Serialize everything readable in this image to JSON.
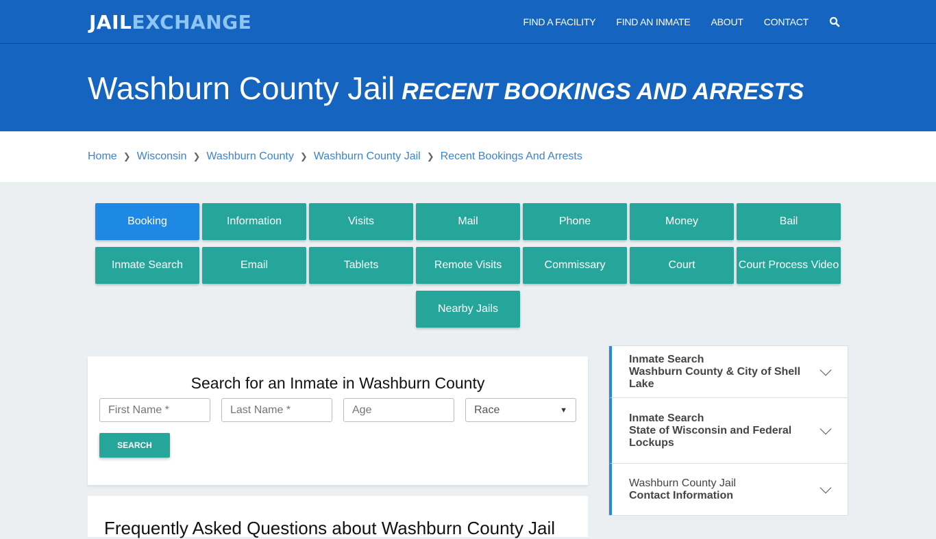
{
  "header": {
    "logo_part1": "JAIL",
    "logo_part2": "EXCHANGE",
    "nav": [
      "FIND A FACILITY",
      "FIND AN INMATE",
      "ABOUT",
      "CONTACT"
    ],
    "search_icon": "search-icon"
  },
  "hero": {
    "title": "Washburn County Jail",
    "subtitle": "RECENT BOOKINGS AND ARRESTS"
  },
  "breadcrumb": [
    "Home",
    "Wisconsin",
    "Washburn County",
    "Washburn County Jail",
    "Recent Bookings And Arrests"
  ],
  "tiles": [
    {
      "label": "Booking",
      "active": true
    },
    {
      "label": "Information"
    },
    {
      "label": "Visits"
    },
    {
      "label": "Mail"
    },
    {
      "label": "Phone"
    },
    {
      "label": "Money"
    },
    {
      "label": "Bail"
    },
    {
      "label": "Inmate Search"
    },
    {
      "label": "Email"
    },
    {
      "label": "Tablets"
    },
    {
      "label": "Remote Visits"
    },
    {
      "label": "Commissary"
    },
    {
      "label": "Court"
    },
    {
      "label": "Court Process Video"
    },
    {
      "label": "Nearby Jails"
    }
  ],
  "search": {
    "title": "Search for an Inmate in Washburn County",
    "first_name_placeholder": "First Name *",
    "last_name_placeholder": "Last Name *",
    "age_placeholder": "Age",
    "race_selected": "Race",
    "button": "SEARCH"
  },
  "faq": {
    "title": "Frequently Asked Questions about Washburn County Jail"
  },
  "sidebar": [
    {
      "line1": "Inmate Search",
      "line2": "Washburn County & City of Shell Lake"
    },
    {
      "line1": "Inmate Search",
      "line2": "State of Wisconsin and Federal Lockups"
    },
    {
      "line1": "Washburn County Jail",
      "line2": "Contact Information"
    }
  ],
  "colors": {
    "primary": "#1565c0",
    "teal": "#26a69a",
    "active": "#1e88e5",
    "link": "#3b82d4"
  }
}
